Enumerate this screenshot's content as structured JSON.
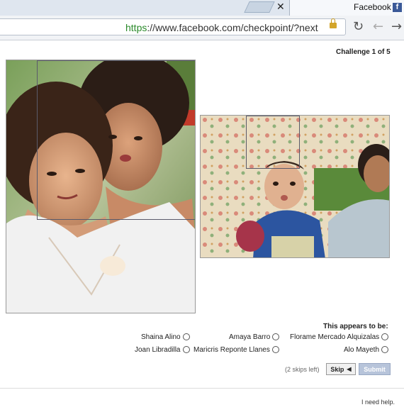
{
  "browser": {
    "tab_title": "Facebook",
    "tab_favicon": "f",
    "url_scheme": "https",
    "url_rest": "://www.facebook.com/checkpoint/?next",
    "icons": {
      "close": "close-icon",
      "back": "back-arrow-icon",
      "forward": "forward-arrow-icon",
      "reload": "reload-icon",
      "lock": "lock-icon"
    }
  },
  "page": {
    "challenge_label": "Challenge 1 of 5",
    "question": "This appears to be:",
    "options": [
      {
        "label": "Florame Mercado Alquizalas"
      },
      {
        "label": "Amaya Barro"
      },
      {
        "label": "Shaina Alino"
      },
      {
        "label": "Alo Mayeth"
      },
      {
        "label": "Maricris Reponte Llanes"
      },
      {
        "label": "Joan Libradilla"
      }
    ],
    "submit_label": "Submit",
    "skip_label": "Skip",
    "skips_left": "(2 skips left)",
    "help_label": "I need help."
  },
  "colors": {
    "facebook_blue": "#3b5998",
    "submit_disabled": "#b7c4da"
  }
}
